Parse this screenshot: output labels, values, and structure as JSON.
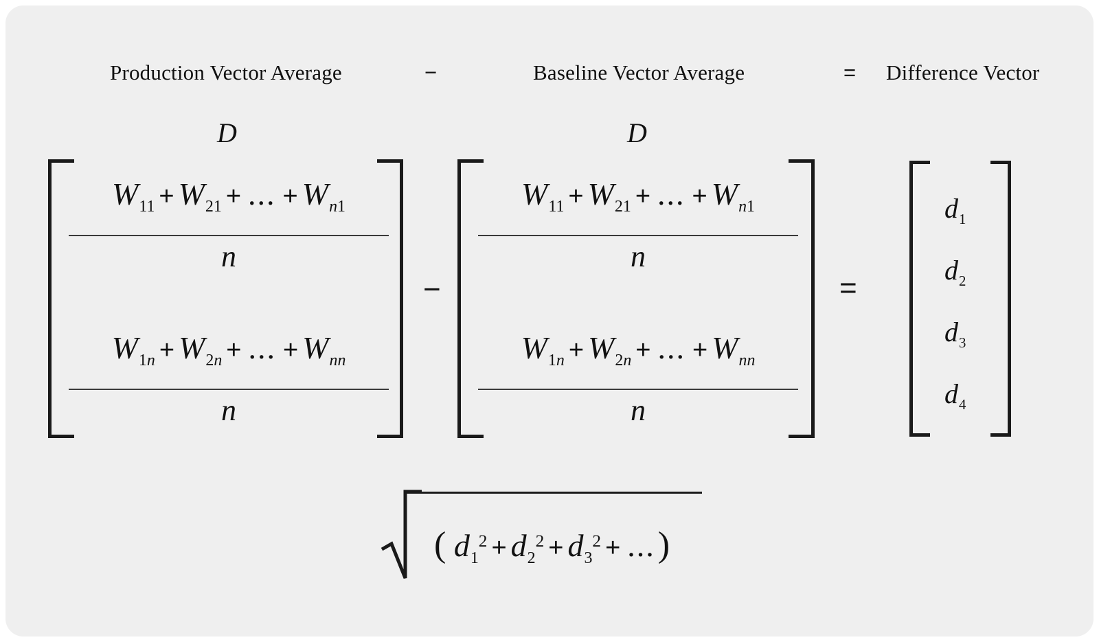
{
  "figure": {
    "background_color": "#efefef",
    "page_color": "#ffffff",
    "ink_color": "#111111"
  },
  "header": {
    "term1": "Production Vector Average",
    "operator_minus": "−",
    "term2": "Baseline Vector Average",
    "operator_equals": "=",
    "term3": "Difference Vector"
  },
  "operators": {
    "minus": "−",
    "equals": "=",
    "plus": "+",
    "ellipsis": "...",
    "open_paren": "(",
    "close_paren": ")"
  },
  "matrix1": {
    "label": "D",
    "rows": [
      {
        "numerator": {
          "t1_base": "W",
          "t1_sub_a": "1",
          "t1_sub_b": "1",
          "t2_base": "W",
          "t2_sub_a": "2",
          "t2_sub_b": "1",
          "t3_base": "W",
          "t3_sub_a": "n",
          "t3_sub_b": "1"
        },
        "denominator": "n"
      },
      {
        "numerator": {
          "t1_base": "W",
          "t1_sub_a": "1",
          "t1_sub_b": "n",
          "t2_base": "W",
          "t2_sub_a": "2",
          "t2_sub_b": "n",
          "t3_base": "W",
          "t3_sub_a": "n",
          "t3_sub_b": "n"
        },
        "denominator": "n"
      }
    ]
  },
  "matrix2": {
    "label": "D",
    "rows": [
      {
        "numerator": {
          "t1_base": "W",
          "t1_sub_a": "1",
          "t1_sub_b": "1",
          "t2_base": "W",
          "t2_sub_a": "2",
          "t2_sub_b": "1",
          "t3_base": "W",
          "t3_sub_a": "n",
          "t3_sub_b": "1"
        },
        "denominator": "n"
      },
      {
        "numerator": {
          "t1_base": "W",
          "t1_sub_a": "1",
          "t1_sub_b": "n",
          "t2_base": "W",
          "t2_sub_a": "2",
          "t2_sub_b": "n",
          "t3_base": "W",
          "t3_sub_a": "n",
          "t3_sub_b": "n"
        },
        "denominator": "n"
      }
    ]
  },
  "difference_vector": {
    "entries": [
      {
        "base": "d",
        "sub": "1"
      },
      {
        "base": "d",
        "sub": "2"
      },
      {
        "base": "d",
        "sub": "3"
      },
      {
        "base": "d",
        "sub": "4"
      }
    ]
  },
  "magnitude_expression": {
    "radical_symbol": "√",
    "terms": [
      {
        "base": "d",
        "sub": "1",
        "sup": "2"
      },
      {
        "base": "d",
        "sub": "2",
        "sup": "2"
      },
      {
        "base": "d",
        "sub": "3",
        "sup": "2"
      }
    ],
    "trailing": "..."
  }
}
